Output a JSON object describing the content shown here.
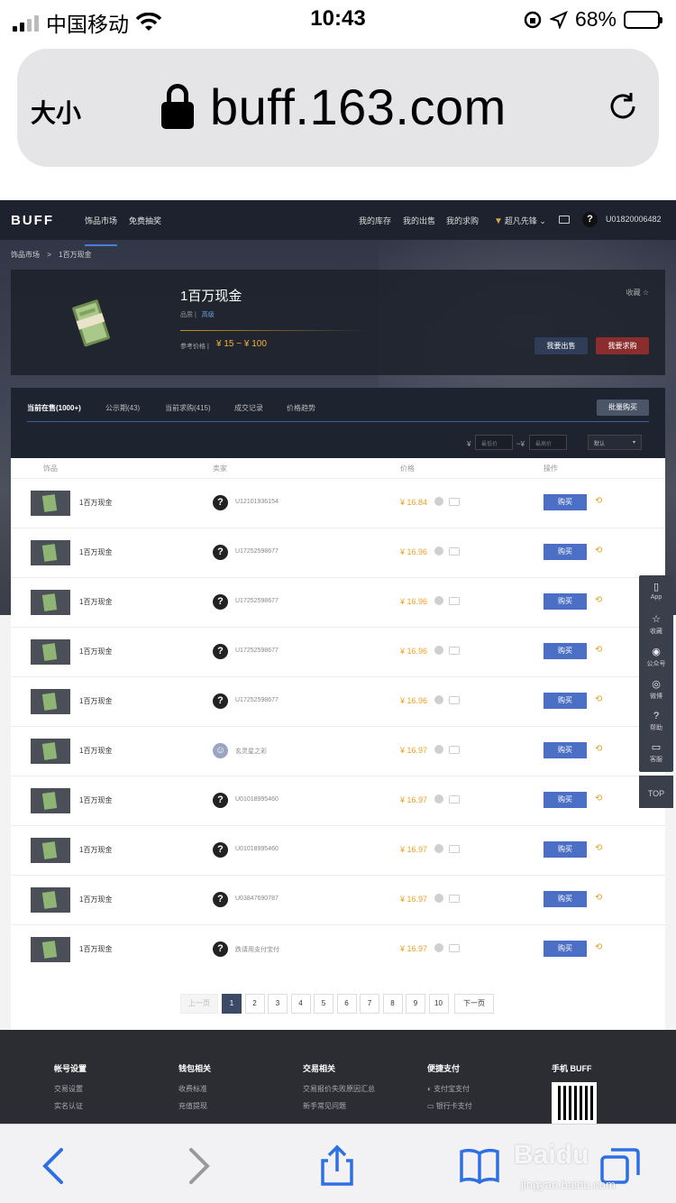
{
  "status_bar": {
    "carrier": "中国移动",
    "time": "10:43",
    "battery": "68%"
  },
  "url_bar": {
    "text_size": "大小",
    "url": "buff.163.com"
  },
  "nav": {
    "logo": "BUFF",
    "items": [
      "饰品市场",
      "免费抽奖"
    ],
    "right": [
      "我的库存",
      "我的出售",
      "我的求购",
      "超凡先锋"
    ],
    "user_id": "U01820006482"
  },
  "breadcrumb": [
    "饰品市场",
    ">",
    "1百万现金"
  ],
  "item": {
    "name": "1百万现金",
    "grade_label": "品质 |",
    "grade": "高级",
    "ref_label": "参考价格 |",
    "ref_price": "¥ 15 ~ ¥ 100",
    "favorite": "收藏 ☆",
    "sell_btn": "我要出售",
    "buy_req_btn": "我要求购"
  },
  "tabs": [
    "当前在售(1000+)",
    "公示期(43)",
    "当前求购(415)",
    "成交记录",
    "价格趋势"
  ],
  "bulk_buy": "批量购买",
  "filter": {
    "min_placeholder": "最低价",
    "max_placeholder": "最高价",
    "sort": "默认",
    "yen": "¥",
    "dash": "~¥"
  },
  "table": {
    "headers": [
      "饰品",
      "卖家",
      "价格",
      "操作"
    ],
    "buy_label": "购买",
    "rows": [
      {
        "name": "1百万现金",
        "seller": "U12101936154",
        "price": "¥ 16.84"
      },
      {
        "name": "1百万现金",
        "seller": "U17252598677",
        "price": "¥ 16.96"
      },
      {
        "name": "1百万现金",
        "seller": "U17252598677",
        "price": "¥ 16.96"
      },
      {
        "name": "1百万现金",
        "seller": "U17252598677",
        "price": "¥ 16.96"
      },
      {
        "name": "1百万现金",
        "seller": "U17252598677",
        "price": "¥ 16.96"
      },
      {
        "name": "1百万现金",
        "seller": "玄灵星之彩",
        "price": "¥ 16.97"
      },
      {
        "name": "1百万现金",
        "seller": "U01018995460",
        "price": "¥ 16.97"
      },
      {
        "name": "1百万现金",
        "seller": "U01018995460",
        "price": "¥ 16.97"
      },
      {
        "name": "1百万现金",
        "seller": "U03847690787",
        "price": "¥ 16.97"
      },
      {
        "name": "1百万现金",
        "seller": "跌请用支付宝付",
        "price": "¥ 16.97"
      }
    ]
  },
  "pagination": {
    "prev": "上一页",
    "pages": [
      "1",
      "2",
      "3",
      "4",
      "5",
      "6",
      "7",
      "8",
      "9",
      "10"
    ],
    "next": "下一页"
  },
  "side_tools": [
    "App",
    "收藏",
    "公众号",
    "微博",
    "帮助",
    "客服"
  ],
  "top_btn": "TOP",
  "footer": {
    "cols": [
      {
        "head": "帐号设置",
        "items": [
          "交易设置",
          "实名认证"
        ]
      },
      {
        "head": "钱包相关",
        "items": [
          "收费标准",
          "充值提现"
        ]
      },
      {
        "head": "交易相关",
        "items": [
          "交易报价失败原因汇总",
          "新手常见问题"
        ]
      },
      {
        "head": "便捷支付",
        "items": [
          "支付宝支付",
          "银行卡支付"
        ]
      },
      {
        "head": "手机 BUFF",
        "items": []
      }
    ]
  },
  "watermark": {
    "brand": "Baidu",
    "sub": "jingyan.baidu.com"
  },
  "colors": {
    "accent": "#4b6fc4",
    "price": "#f0a020",
    "sell_red": "#8c2d2d"
  }
}
